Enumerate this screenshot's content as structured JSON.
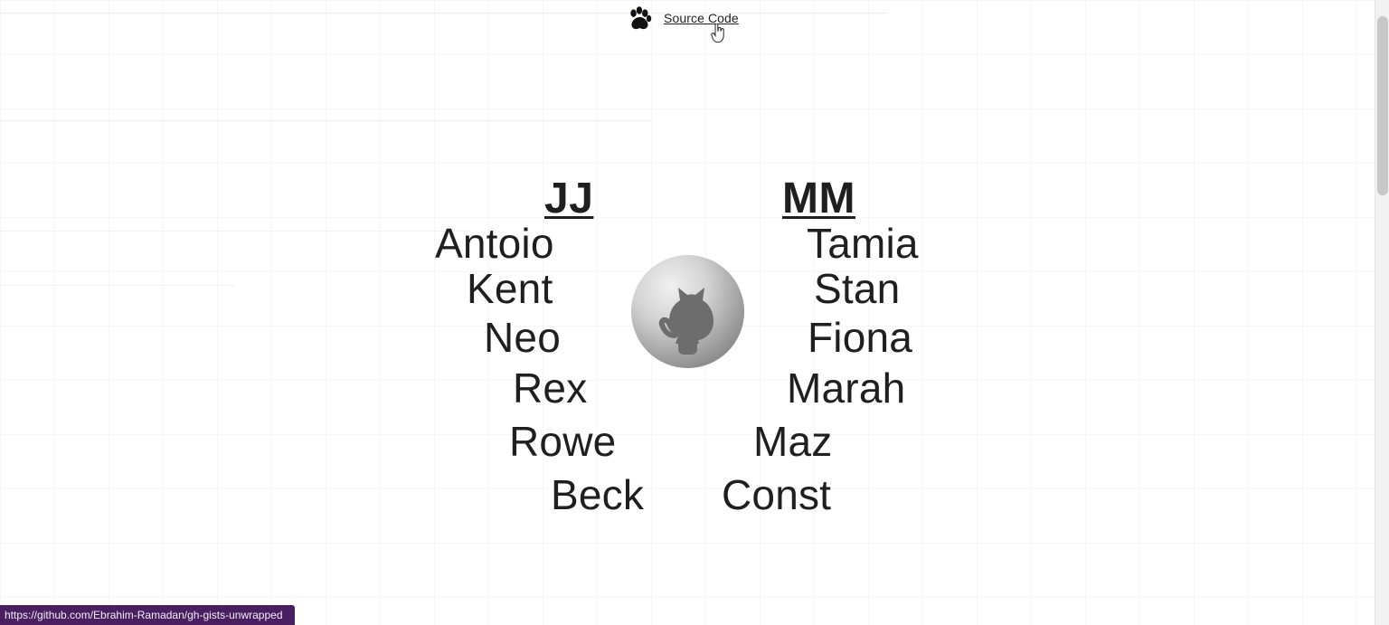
{
  "top_link": {
    "text": "Source Code",
    "icon": "paw-icon"
  },
  "groups": {
    "left": {
      "header": "JJ",
      "names": [
        "Antoio",
        "Kent",
        "Neo",
        "Rex",
        "Rowe",
        "Beck"
      ]
    },
    "right": {
      "header": "MM",
      "names": [
        "Tamia",
        "Stan",
        "Fiona",
        "Marah",
        "Maz",
        "Const"
      ]
    }
  },
  "center_avatar": {
    "icon": "github-octocat-icon"
  },
  "status_bar": {
    "url": "https://github.com/Ebrahim-Ramadan/gh-gists-unwrapped"
  },
  "colors": {
    "text": "#1f1f1f",
    "status_bar_bg": "#4a1f61",
    "status_bar_text": "#f3edf8",
    "scroll_thumb": "#c7c7c7"
  }
}
